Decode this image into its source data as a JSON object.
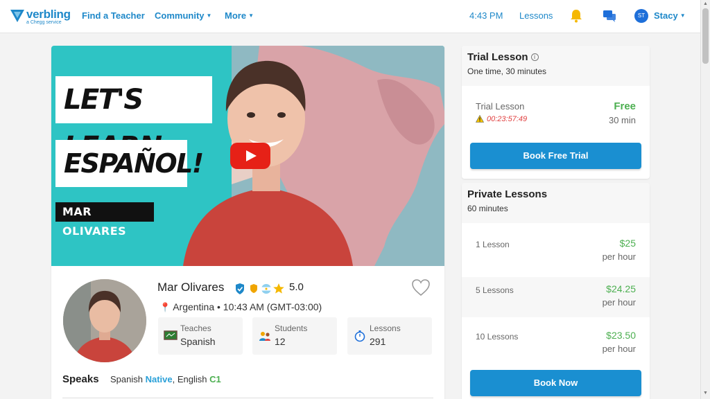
{
  "nav": {
    "logo_text": "verbling",
    "logo_sub": "a Chegg service",
    "find_teacher": "Find a Teacher",
    "community": "Community",
    "more": "More",
    "time": "4:43 PM",
    "lessons": "Lessons",
    "user_initials": "ST",
    "user_name": "Stacy"
  },
  "video": {
    "line1": "LET'S LEARN",
    "line2": "ESPAÑOL!",
    "line3": "MAR OLIVARES"
  },
  "teacher": {
    "name": "Mar Olivares",
    "rating": "5.0",
    "location": "Argentina • 10:43 AM (GMT-03:00)",
    "stats": [
      {
        "label": "Teaches",
        "value": "Spanish",
        "icon": "chalkboard-icon"
      },
      {
        "label": "Students",
        "value": "12",
        "icon": "students-icon"
      },
      {
        "label": "Lessons",
        "value": "291",
        "icon": "stopwatch-icon"
      }
    ],
    "speaks_label": "Speaks",
    "speaks": {
      "lang1": "Spanish",
      "lvl1": "Native",
      "sep": ", ",
      "lang2": "English",
      "lvl2": "C1"
    }
  },
  "trial": {
    "title": "Trial Lesson",
    "subtitle": "One time, 30 minutes",
    "row_label": "Trial Lesson",
    "price": "Free",
    "duration": "30 min",
    "countdown": "00:23:57:49",
    "button": "Book Free Trial"
  },
  "private": {
    "title": "Private Lessons",
    "subtitle": "60 minutes",
    "rows": [
      {
        "label": "1 Lesson",
        "price": "$25",
        "per": "per hour"
      },
      {
        "label": "5 Lessons",
        "price": "$24.25",
        "per": "per hour"
      },
      {
        "label": "10 Lessons",
        "price": "$23.50",
        "per": "per hour"
      }
    ],
    "button": "Book Now"
  },
  "colors": {
    "accent": "#1e88c9",
    "button": "#1a8fd1",
    "price_green": "#4caf50",
    "video_bg": "#2ec4c4"
  }
}
